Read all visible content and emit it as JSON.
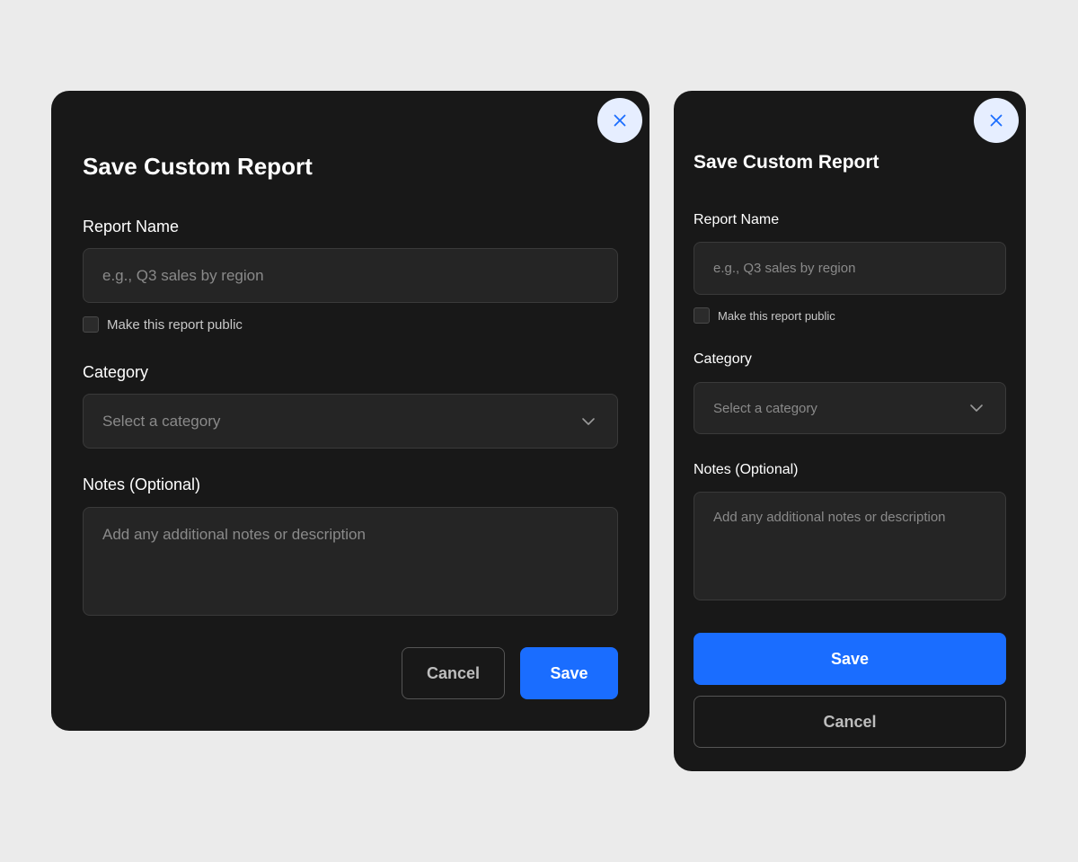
{
  "colors": {
    "page_background": "#ebebeb",
    "modal_background": "#181818",
    "field_background": "#252525",
    "primary": "#1a6dff",
    "close_button_background": "#e6eeff",
    "close_icon": "#1a6dff"
  },
  "desktop": {
    "title": "Save Custom Report",
    "report_name": {
      "label": "Report Name",
      "placeholder": "e.g., Q3 sales by region",
      "value": ""
    },
    "public_checkbox": {
      "label": "Make this report public",
      "checked": false
    },
    "category": {
      "label": "Category",
      "placeholder": "Select a category"
    },
    "notes": {
      "label": "Notes (Optional)",
      "placeholder": "Add any additional notes or description"
    },
    "buttons": {
      "cancel": "Cancel",
      "save": "Save"
    },
    "icons": {
      "close": "close-icon",
      "dropdown": "chevron-down-icon"
    }
  },
  "mobile": {
    "title": "Save Custom Report",
    "report_name": {
      "label": "Report Name",
      "placeholder": "e.g., Q3 sales by region",
      "value": ""
    },
    "public_checkbox": {
      "label": "Make this report public",
      "checked": false
    },
    "category": {
      "label": "Category",
      "placeholder": "Select a category"
    },
    "notes": {
      "label": "Notes (Optional)",
      "placeholder": "Add any additional notes or description"
    },
    "buttons": {
      "save": "Save",
      "cancel": "Cancel"
    },
    "icons": {
      "close": "close-icon",
      "dropdown": "chevron-down-icon"
    }
  }
}
